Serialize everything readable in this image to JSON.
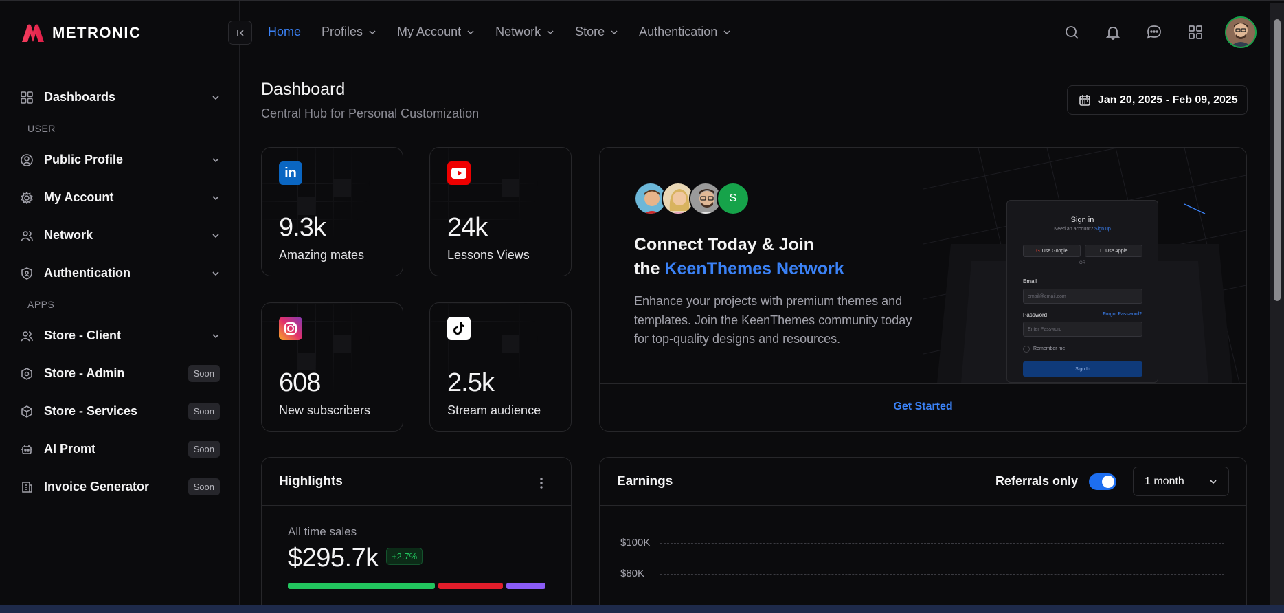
{
  "brand": {
    "name": "METRONIC",
    "accent": "#3b82f6",
    "logo_color": "#f43f5e"
  },
  "sidebar": {
    "items": [
      {
        "label": "Dashboards",
        "icon": "dashboard-grid-icon",
        "has_chevron": true
      },
      {
        "section": "USER"
      },
      {
        "label": "Public Profile",
        "icon": "user-circle-icon",
        "has_chevron": true
      },
      {
        "label": "My Account",
        "icon": "gear-icon",
        "has_chevron": true
      },
      {
        "label": "Network",
        "icon": "users-icon",
        "has_chevron": true
      },
      {
        "label": "Authentication",
        "icon": "shield-icon",
        "has_chevron": true
      },
      {
        "section": "APPS"
      },
      {
        "label": "Store - Client",
        "icon": "users-icon",
        "has_chevron": true
      },
      {
        "label": "Store - Admin",
        "icon": "hexagon-icon",
        "badge": "Soon"
      },
      {
        "label": "Store - Services",
        "icon": "cube-icon",
        "badge": "Soon"
      },
      {
        "label": "AI Promt",
        "icon": "ai-icon",
        "badge": "Soon"
      },
      {
        "label": "Invoice Generator",
        "icon": "invoice-icon",
        "badge": "Soon"
      }
    ]
  },
  "topnav": {
    "items": [
      {
        "label": "Home",
        "active": true
      },
      {
        "label": "Profiles"
      },
      {
        "label": "My Account"
      },
      {
        "label": "Network"
      },
      {
        "label": "Store"
      },
      {
        "label": "Authentication"
      }
    ]
  },
  "header": {
    "title": "Dashboard",
    "subtitle": "Central Hub for Personal Customization",
    "date_range": "Jan 20, 2025 - Feb 09, 2025"
  },
  "stats": [
    {
      "value": "9.3k",
      "label": "Amazing mates",
      "icon": "linkedin-icon",
      "color": "#0a66c2"
    },
    {
      "value": "24k",
      "label": "Lessons Views",
      "icon": "youtube-icon",
      "color": "#ff0000"
    },
    {
      "value": "608",
      "label": "New subscribers",
      "icon": "instagram-icon",
      "color": "#e1306c"
    },
    {
      "value": "2.5k",
      "label": "Stream audience",
      "icon": "tiktok-icon",
      "color": "#ffffff"
    }
  ],
  "connect": {
    "title_line1": "Connect Today & Join",
    "title_line2_prefix": "the ",
    "title_line2_highlight": "KeenThemes Network",
    "description": "Enhance your projects with premium themes and templates. Join the KeenThemes community today for top-quality designs and resources.",
    "avatar_initial": "S",
    "cta": "Get Started",
    "mock_signin": {
      "title": "Sign in",
      "need_account": "Need an account?",
      "signup": "Sign up",
      "google": "Use Google",
      "apple": "Use Apple",
      "or": "OR",
      "email_label": "Email",
      "email_placeholder": "email@email.com",
      "password_label": "Password",
      "forgot": "Forgot Password?",
      "password_placeholder": "Enter Password",
      "remember": "Remember me",
      "submit": "Sign In"
    }
  },
  "highlights": {
    "title": "Highlights",
    "subtitle": "All time sales",
    "value": "$295.7k",
    "badge": "+2.7%",
    "bar_colors": [
      "#22c55e",
      "#e11d2a",
      "#8b5cf6"
    ]
  },
  "earnings": {
    "title": "Earnings",
    "toggle_label": "Referrals only",
    "toggle_on": true,
    "period": "1 month",
    "chart_data": {
      "type": "area",
      "y_ticks": [
        "$100K",
        "$80K"
      ]
    }
  }
}
